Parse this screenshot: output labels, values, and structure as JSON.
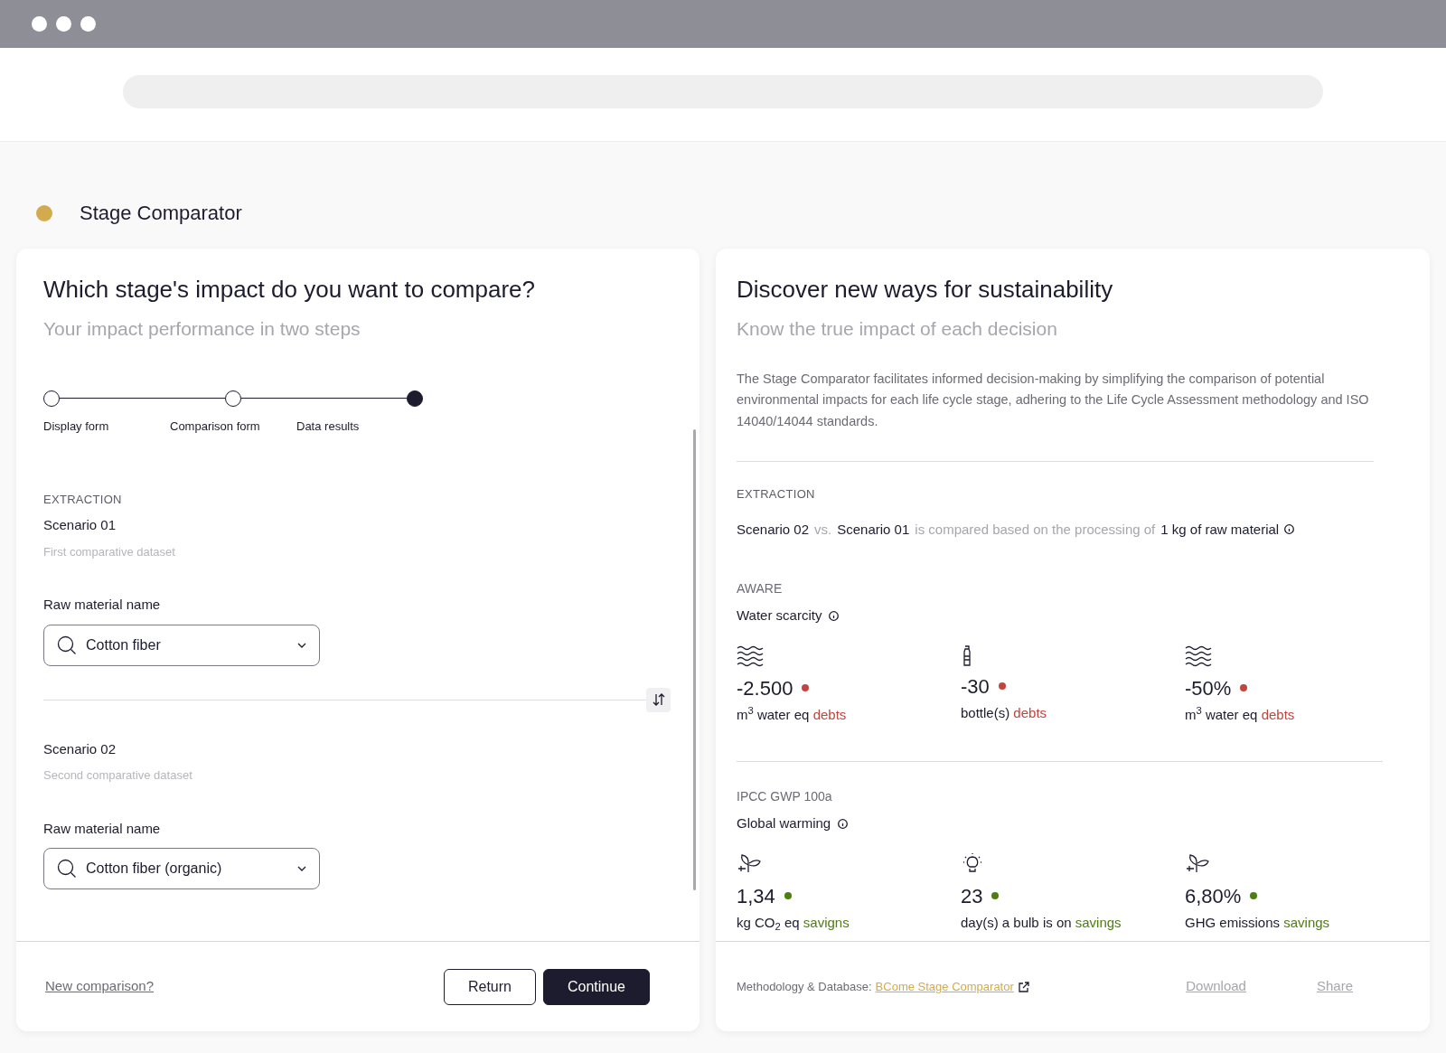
{
  "page_title": "Stage Comparator",
  "form_panel": {
    "heading": "Which stage's impact do you want to compare?",
    "subheading": "Your impact performance in two steps",
    "steps": [
      {
        "label": "Display form",
        "selected": false
      },
      {
        "label": "Comparison form",
        "selected": false
      },
      {
        "label": "Data results",
        "selected": true
      }
    ],
    "section_label": "EXTRACTION",
    "scenarios": [
      {
        "title": "Scenario 01",
        "subtitle": "First comparative dataset",
        "field_label": "Raw material name",
        "value": "Cotton fiber"
      },
      {
        "title": "Scenario 02",
        "subtitle": "Second comparative dataset",
        "field_label": "Raw material name",
        "value": "Cotton fiber (organic)"
      }
    ],
    "footer": {
      "link": "New comparison?",
      "buttons": [
        {
          "label": "Return",
          "kind": "outline"
        },
        {
          "label": "Continue",
          "kind": "primary"
        }
      ]
    }
  },
  "results_panel": {
    "heading": "Discover new ways for sustainability",
    "subheading": "Know the true impact of each decision",
    "description": "The Stage Comparator facilitates informed decision-making by simplifying the comparison of potential environmental impacts for each life cycle stage, adhering to the Life Cycle Assessment methodology and ISO 14040/14044 standards.",
    "section_label": "EXTRACTION",
    "comparison": [
      {
        "text": "Scenario 02",
        "kind": "strong"
      },
      {
        "text": "vs.",
        "kind": "muted"
      },
      {
        "text": "Scenario 01",
        "kind": "strong"
      },
      {
        "text": "is compared based on the processing of",
        "kind": "muted"
      },
      {
        "text": "1 kg of raw material",
        "kind": "strong"
      }
    ],
    "impacts": [
      {
        "method": "AWARE",
        "name": "Water scarcity",
        "metrics": [
          {
            "kind": "water",
            "value": "-2.500",
            "unit": "m$^{3}$ water eq",
            "outcome": "debts",
            "color": "#c0453f"
          },
          {
            "kind": "bottle",
            "value": "-30",
            "unit": "bottle(s)",
            "outcome": "debts",
            "color": "#c0453f"
          },
          {
            "kind": "water",
            "value": "-50%",
            "unit": "m$^{3}$ water eq",
            "outcome": "debts",
            "color": "#c0453f"
          }
        ]
      },
      {
        "method": "IPCC GWP 100a",
        "name": "Global warming",
        "metrics": [
          {
            "kind": "plant",
            "value": "1,34",
            "unit": "kg CO$_{2}$ eq",
            "outcome": "savigns",
            "color": "#4e7d12"
          },
          {
            "kind": "bulb",
            "value": "23",
            "unit": "day(s) a bulb is on",
            "outcome": "savings",
            "color": "#4e7d12"
          },
          {
            "kind": "plant",
            "value": "6,80%",
            "unit": "GHG emissions",
            "outcome": "savings",
            "color": "#4e7d12"
          }
        ]
      }
    ],
    "footer": {
      "label": "Methodology & Database:",
      "link": "BCome Stage Comparator",
      "actions": [
        "Download",
        "Share"
      ]
    }
  }
}
